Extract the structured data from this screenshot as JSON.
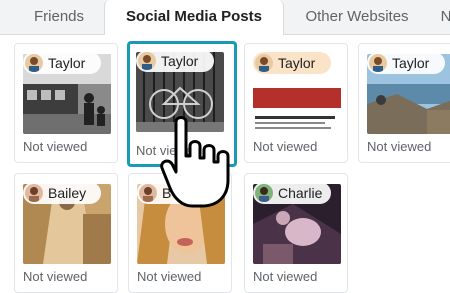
{
  "tabs": [
    {
      "label": "Friends",
      "active": false
    },
    {
      "label": "Social Media Posts",
      "active": true
    },
    {
      "label": "Other Websites",
      "active": false
    },
    {
      "label": "N",
      "active": false
    }
  ],
  "posts": [
    {
      "author": "Taylor",
      "status": "Not viewed",
      "selected": false,
      "image": "train-station-family"
    },
    {
      "author": "Taylor",
      "status": "Not viewed",
      "selected": true,
      "image": "bicycle-fence"
    },
    {
      "author": "Taylor",
      "status": "Not viewed",
      "selected": false,
      "image": "news-article-screenshot"
    },
    {
      "author": "Taylor",
      "status": "Not viewed",
      "selected": false,
      "image": "harbor-rocks"
    },
    {
      "author": "Bailey",
      "status": "Not viewed",
      "selected": false,
      "image": "fashion-collage"
    },
    {
      "author": "B",
      "status": "Not viewed",
      "selected": false,
      "image": "portrait-woman"
    },
    {
      "author": "Charlie",
      "status": "Not viewed",
      "selected": false,
      "image": "dark-figures-photo"
    }
  ],
  "colors": {
    "selection_border": "#1a9bb5",
    "tab_bar": "#f1f3f4",
    "pill_highlight": "#fbe3c8"
  },
  "cursor": {
    "icon": "hand-pointer-icon"
  }
}
